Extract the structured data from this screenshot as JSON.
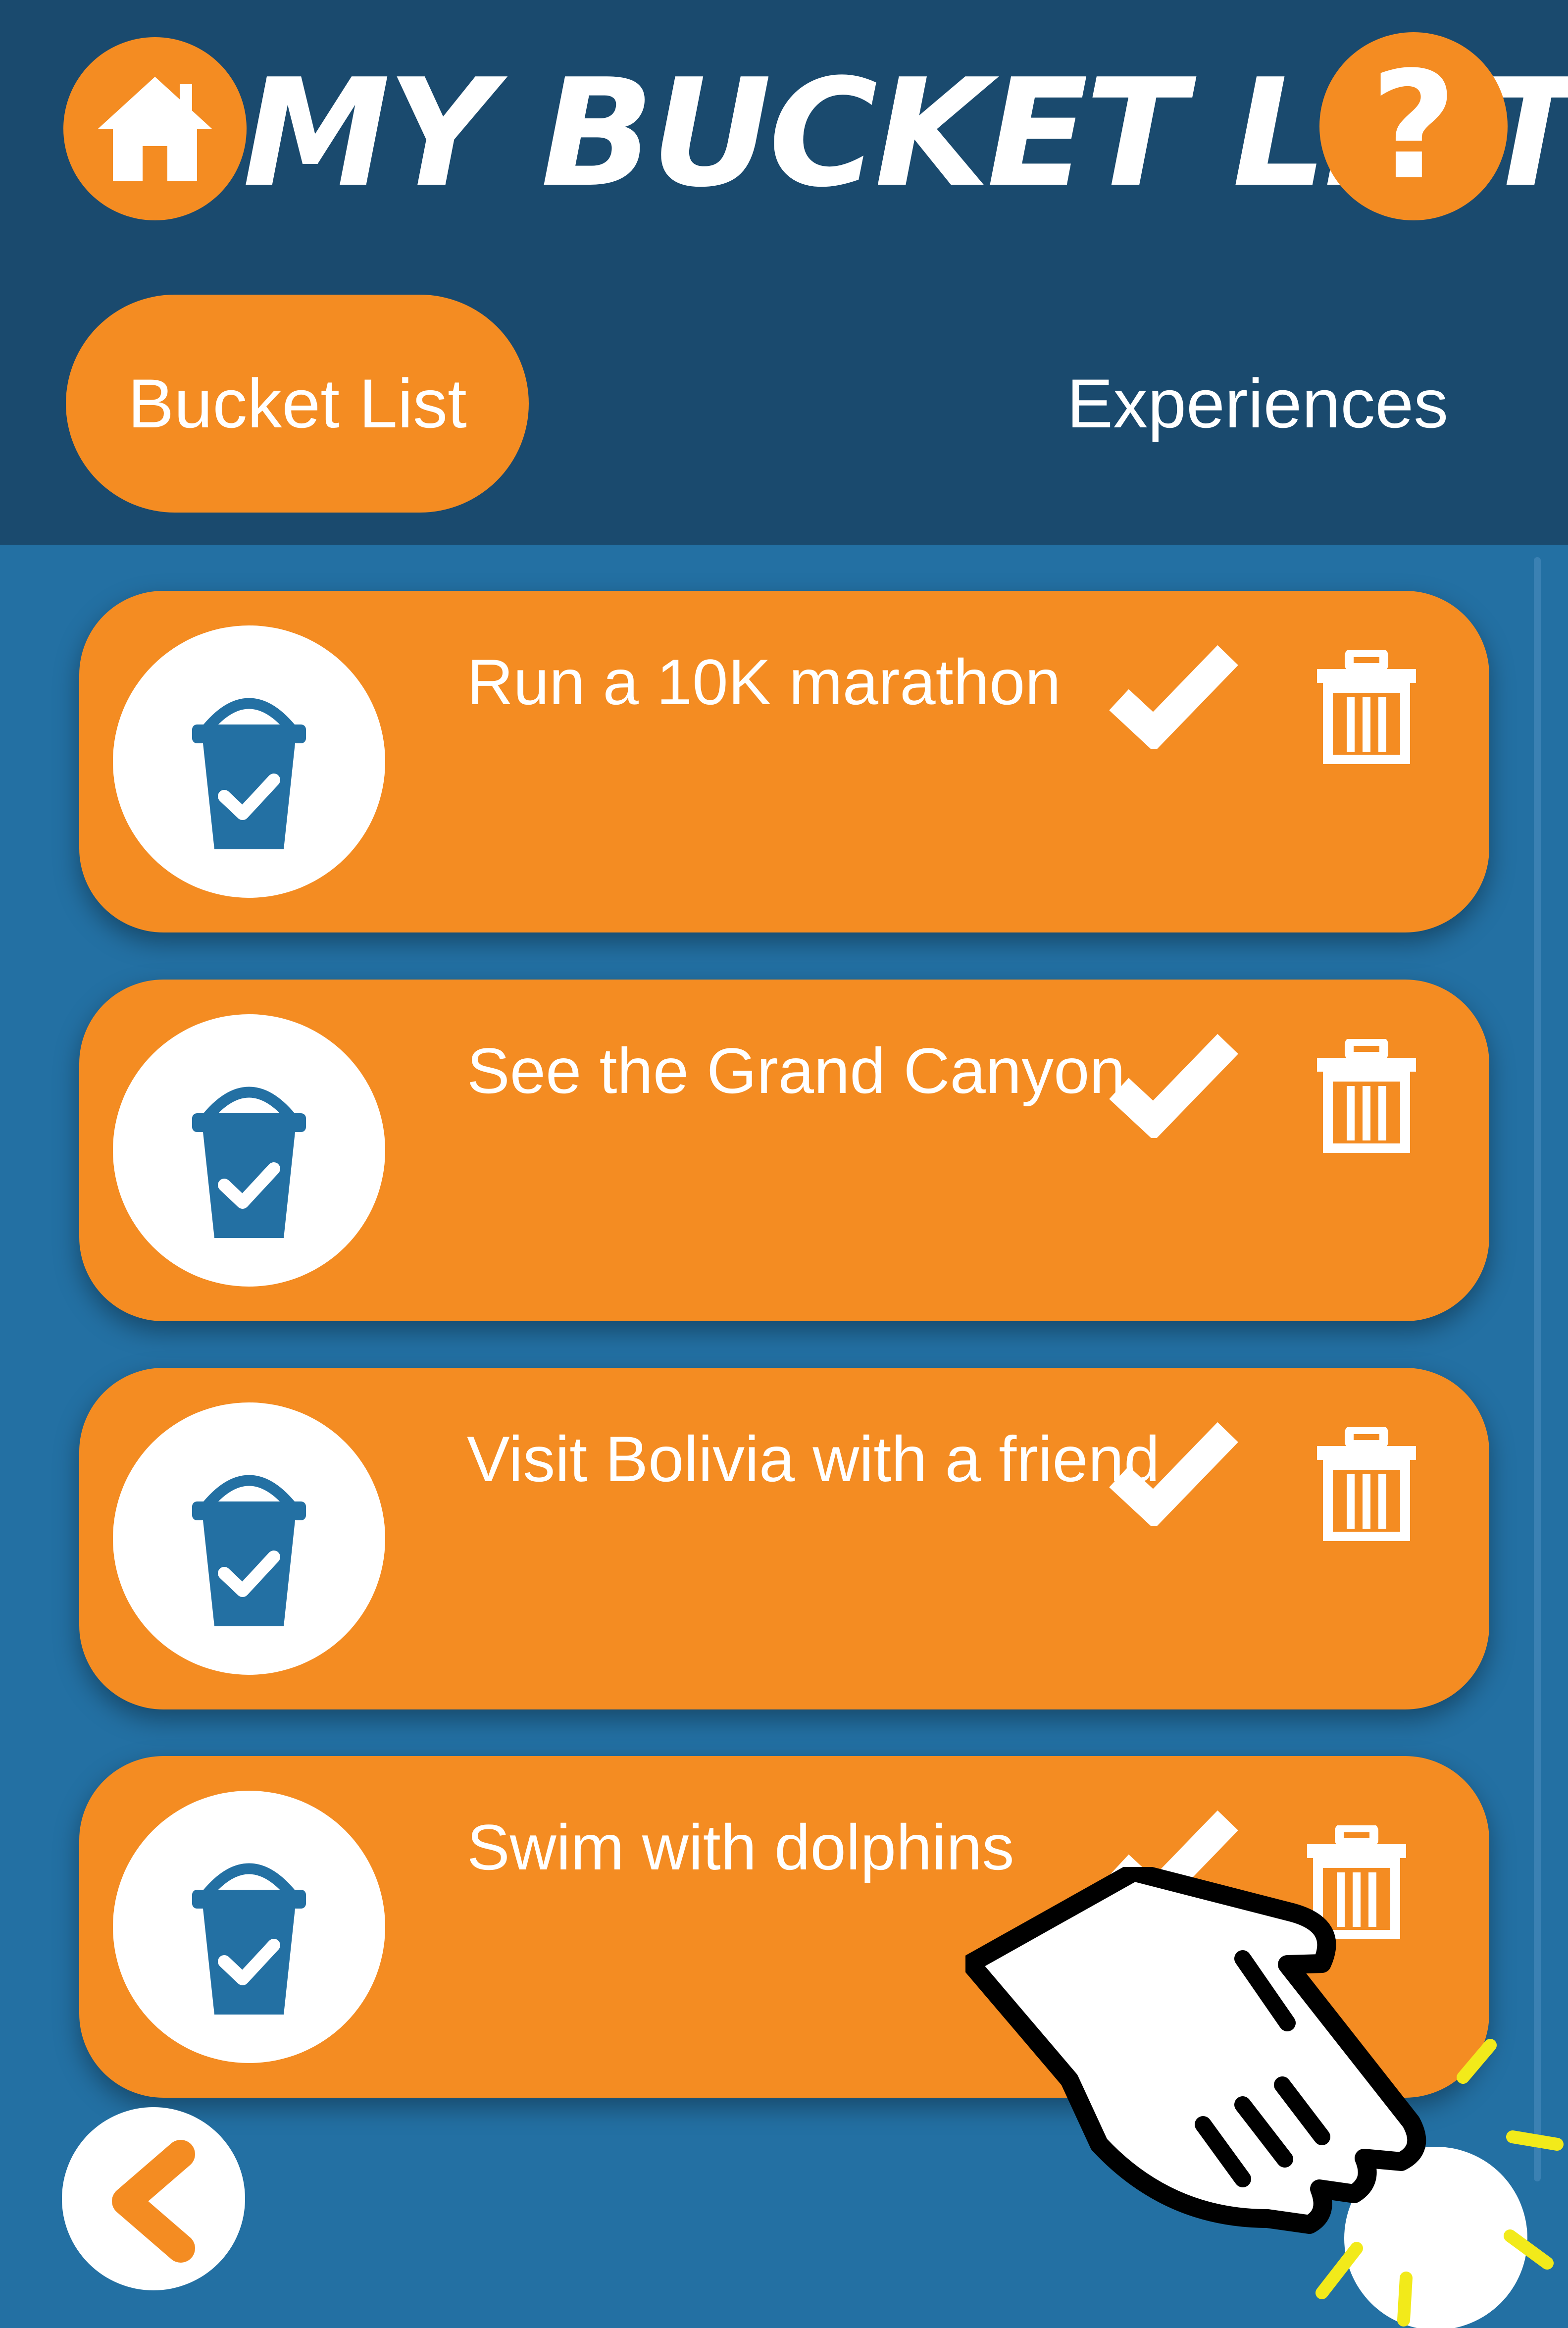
{
  "header": {
    "title": "MY BUCKET LIST",
    "home_icon": "home-icon",
    "help_icon": "help-icon",
    "help_glyph": "?"
  },
  "tabs": [
    {
      "label": "Bucket List",
      "active": true
    },
    {
      "label": "Experiences",
      "active": false
    }
  ],
  "items": [
    {
      "text": "Run a 10K marathon",
      "icon": "bucket-check-icon"
    },
    {
      "text": "See the Grand Canyon",
      "icon": "bucket-check-icon"
    },
    {
      "text": "Visit Bolivia with a friend",
      "icon": "bucket-check-icon"
    },
    {
      "text": "Swim with dolphins",
      "icon": "bucket-check-icon"
    }
  ],
  "footer": {
    "back_icon": "chevron-left-icon",
    "pointer_icon": "hand-pointer-icon"
  },
  "colors": {
    "header_bg": "#1a4a6e",
    "content_bg": "#2370a3",
    "accent": "#f48c22",
    "white": "#ffffff"
  }
}
